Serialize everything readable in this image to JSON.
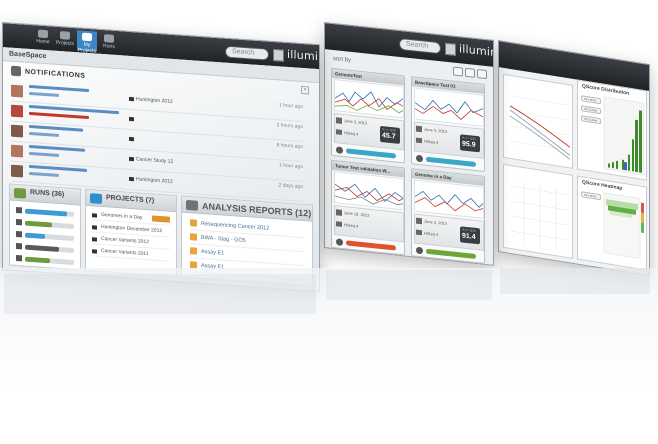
{
  "screen1": {
    "brand": "illumina",
    "search_placeholder": "Search",
    "app_name": "BaseSpace",
    "nav_tabs": [
      {
        "label": "Home",
        "active": false
      },
      {
        "label": "Projects",
        "active": false
      },
      {
        "label": "My Projects",
        "active": true
      },
      {
        "label": "Runs",
        "active": false
      }
    ],
    "notifications": {
      "title": "NOTIFICATIONS",
      "items": [
        {
          "project": "Huntington 2012",
          "time": "1 hour ago"
        },
        {
          "project": "",
          "time": "2 hours ago"
        },
        {
          "project": "",
          "time": "8 hours ago"
        },
        {
          "project": "Cancer Study 12",
          "time": "1 hour ago"
        },
        {
          "project": "Huntington 2012",
          "time": "2 days ago"
        }
      ]
    },
    "runs": {
      "title": "RUNS (36)",
      "progress": [
        0.85,
        0.55,
        0.4,
        0.7,
        0.5
      ],
      "colors": [
        "#3d9ad8",
        "#6e9b3d",
        "#3d9ad8",
        "#555a5f",
        "#6e9b3d"
      ]
    },
    "projects": {
      "title": "PROJECTS (7)",
      "items": [
        "Genomes in a Day",
        "Huntington December 2012",
        "Cancer Variants 2012",
        "Cancer Variants 2011"
      ]
    },
    "analysis_reports": {
      "title": "ANALYSIS REPORTS (12)",
      "items": [
        "Resequencing Cancer 2012",
        "BWA - Stag - GO5",
        "Assay E1",
        "Assay E1"
      ]
    }
  },
  "screen2": {
    "search_placeholder": "Search",
    "brand": "illumina",
    "sort_label": "sort by",
    "cards": [
      {
        "title": "GenomeTest",
        "date": "June 3, 2013",
        "instrument": "HiSeq 4",
        "q30_label": "% >= Q30",
        "q30": "45.7",
        "status_color": "#3aa7c9"
      },
      {
        "title": "BaseSpace Test 01",
        "date": "June 5, 2013",
        "instrument": "HiSeq 4",
        "q30_label": "% >= Q30",
        "q30": "95.9",
        "status_color": "#3aa7c9"
      },
      {
        "title": "Tumor Test validation W...",
        "date": "June 19, 2013",
        "instrument": "HiSeq 4",
        "q30_label": "% >= Q30",
        "q30": "",
        "status_color": "#e0522b"
      },
      {
        "title": "Genome in a Day",
        "date": "June 3, 2013",
        "instrument": "HiSeq 4",
        "q30_label": "% >= Q30",
        "q30": "91.4",
        "status_color": "#6ea53a"
      }
    ]
  },
  "screen3": {
    "panels": [
      {
        "title": ""
      },
      {
        "title": "QScore Distribution",
        "dropdowns": [
          "All Lanes",
          "All Cycles",
          "All Cycles"
        ]
      },
      {
        "title": ""
      },
      {
        "title": "QScore Heatmap",
        "dropdowns": [
          "All Lanes"
        ]
      }
    ]
  }
}
